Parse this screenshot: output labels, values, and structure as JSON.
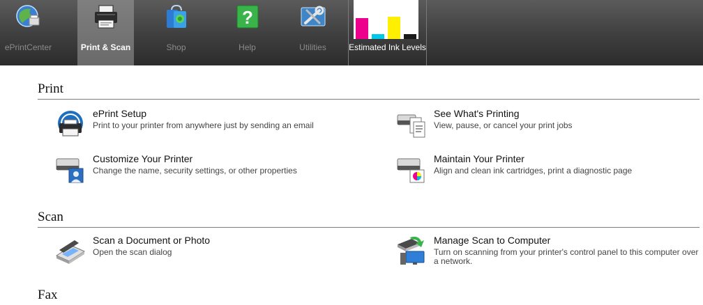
{
  "toolbar": {
    "buttons": [
      {
        "label": "ePrintCenter",
        "icon": "eprint-center-icon"
      },
      {
        "label": "Print & Scan",
        "icon": "printer-icon",
        "active": true
      },
      {
        "label": "Shop",
        "icon": "shopping-bag-icon"
      },
      {
        "label": "Help",
        "icon": "help-icon"
      },
      {
        "label": "Utilities",
        "icon": "utilities-icon"
      }
    ],
    "ink": {
      "label": "Estimated Ink Levels",
      "cartridges": [
        {
          "color": "magenta",
          "hex": "#ec008c",
          "level": 0.53
        },
        {
          "color": "cyan",
          "hex": "#00c8e8",
          "level": 0.12
        },
        {
          "color": "yellow",
          "hex": "#ffef00",
          "level": 0.57
        },
        {
          "color": "black",
          "hex": "#1a1a1a",
          "level": 0.12
        }
      ]
    }
  },
  "sections": {
    "print": {
      "title": "Print",
      "items": [
        {
          "title": "ePrint Setup",
          "desc": "Print to your printer from anywhere just by sending an email",
          "icon": "eprint-setup-icon"
        },
        {
          "title": "See What's Printing",
          "desc": "View, pause, or cancel your print jobs",
          "icon": "print-queue-icon"
        },
        {
          "title": "Customize Your Printer",
          "desc": "Change the name, security settings, or other properties",
          "icon": "printer-properties-icon"
        },
        {
          "title": "Maintain Your Printer",
          "desc": "Align and clean ink cartridges, print a diagnostic page",
          "icon": "printer-maintenance-icon"
        }
      ]
    },
    "scan": {
      "title": "Scan",
      "items": [
        {
          "title": "Scan a Document or Photo",
          "desc": "Open the scan dialog",
          "icon": "scanner-icon"
        },
        {
          "title": "Manage Scan to Computer",
          "desc": "Turn on scanning from your printer's control panel to this computer over a network.",
          "icon": "scan-to-computer-icon"
        }
      ]
    },
    "fax": {
      "title": "Fax"
    }
  }
}
